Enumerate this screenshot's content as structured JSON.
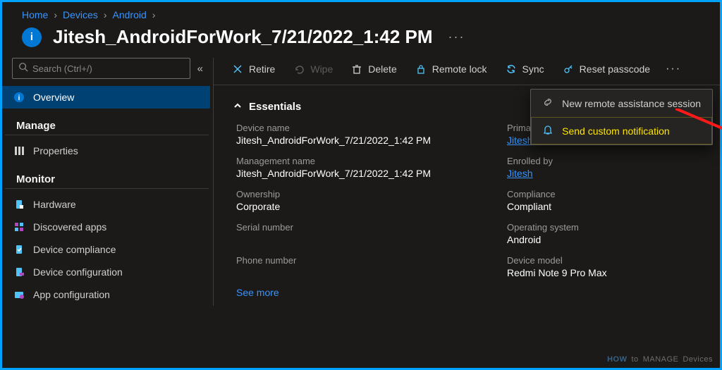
{
  "breadcrumb": [
    "Home",
    "Devices",
    "Android"
  ],
  "page_title": "Jitesh_AndroidForWork_7/21/2022_1:42 PM",
  "search_placeholder": "Search (Ctrl+/)",
  "sidebar": {
    "selected": "Overview",
    "groups": [
      {
        "name": "",
        "items": [
          {
            "label": "Overview",
            "icon": "info-icon",
            "selected": true
          }
        ]
      },
      {
        "name": "Manage",
        "items": [
          {
            "label": "Properties",
            "icon": "properties-icon"
          }
        ]
      },
      {
        "name": "Monitor",
        "items": [
          {
            "label": "Hardware",
            "icon": "hardware-icon"
          },
          {
            "label": "Discovered apps",
            "icon": "apps-icon"
          },
          {
            "label": "Device compliance",
            "icon": "compliance-icon"
          },
          {
            "label": "Device configuration",
            "icon": "deviceconfig-icon"
          },
          {
            "label": "App configuration",
            "icon": "appconfig-icon"
          }
        ]
      }
    ]
  },
  "toolbar": {
    "retire": "Retire",
    "wipe": "Wipe",
    "delete": "Delete",
    "remote_lock": "Remote lock",
    "sync": "Sync",
    "reset_passcode": "Reset passcode"
  },
  "dropdown": {
    "remote_assist": "New remote assistance session",
    "send_notif": "Send custom notification"
  },
  "essentials_title": "Essentials",
  "essentials": {
    "device_name_k": "Device name",
    "device_name_v": "Jitesh_AndroidForWork_7/21/2022_1:42 PM",
    "mgmt_name_k": "Management name",
    "mgmt_name_v": "Jitesh_AndroidForWork_7/21/2022_1:42 PM",
    "ownership_k": "Ownership",
    "ownership_v": "Corporate",
    "serial_k": "Serial number",
    "serial_v": "",
    "phone_k": "Phone number",
    "phone_v": "",
    "primary_user_k": "Primary user",
    "primary_user_v": "Jitesh",
    "enrolled_by_k": "Enrolled by",
    "enrolled_by_v": "Jitesh",
    "compliance_k": "Compliance",
    "compliance_v": "Compliant",
    "os_k": "Operating system",
    "os_v": "Android",
    "model_k": "Device model",
    "model_v": "Redmi Note 9 Pro Max"
  },
  "see_more": "See more",
  "watermark": {
    "a": "HOW",
    "b": "to",
    "c": "MANAGE",
    "d": "Devices"
  }
}
